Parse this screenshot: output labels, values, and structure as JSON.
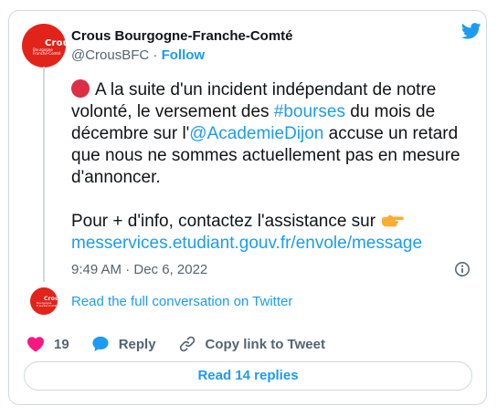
{
  "tweet": {
    "author_name": "Crous Bourgogne-Franche-Comté",
    "handle": "@CrousBFC",
    "separator": "·",
    "follow_label": "Follow",
    "avatar_brand": "Crous",
    "avatar_brand_sub": [
      "Bourgogne",
      "Franche-Comté"
    ],
    "text": {
      "p1_a": "A la suite d'un incident indépendant de notre volonté, le versement des ",
      "hashtag": "#bourses",
      "p1_b": " du mois de décembre sur l'",
      "mention": "@AcademieDijon",
      "p1_c": " accuse un retard que nous ne sommes actuellement pas en mesure d'annoncer.",
      "p2_a": "Pour + d'info, contactez l'assistance sur ",
      "url": "messervices.etudiant.gouv.fr/envole/message"
    },
    "timestamp": "9:49 AM · Dec 6, 2022",
    "read_conversation": "Read the full conversation on Twitter"
  },
  "actions": {
    "like_count": "19",
    "reply_label": "Reply",
    "copy_label": "Copy link to Tweet"
  },
  "footer": {
    "read_replies": "Read 14 replies"
  },
  "colors": {
    "brand_red": "#e2231a",
    "link_blue": "#1d9bf0",
    "like_pink": "#f91880",
    "muted": "#536471"
  },
  "icons": [
    "twitter-bird-icon",
    "red-circle-emoji",
    "pointing-hand-emoji",
    "info-icon",
    "heart-icon",
    "reply-bubble-icon",
    "link-icon"
  ]
}
